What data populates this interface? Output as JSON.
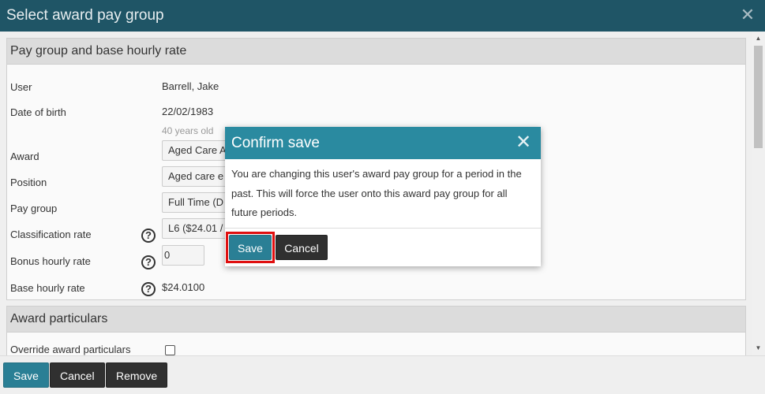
{
  "window": {
    "title": "Select award pay group",
    "close_icon": "close-icon"
  },
  "pay_group_panel": {
    "heading": "Pay group and base hourly rate",
    "user": {
      "label": "User",
      "value": "Barrell, Jake"
    },
    "dob": {
      "label": "Date of birth",
      "value": "22/02/1983",
      "age": "40 years old"
    },
    "award": {
      "label": "Award",
      "value": "Aged Care A"
    },
    "position": {
      "label": "Position",
      "value": "Aged care e"
    },
    "pay_group": {
      "label": "Pay group",
      "value": "Full Time (D"
    },
    "classification_rate": {
      "label": "Classification rate",
      "value": "L6 ($24.01 /"
    },
    "bonus_hourly_rate": {
      "label": "Bonus hourly rate",
      "value": "0"
    },
    "base_hourly_rate": {
      "label": "Base hourly rate",
      "value": "$24.0100"
    },
    "help_glyph": "?"
  },
  "award_particulars_panel": {
    "heading": "Award particulars",
    "override": {
      "label": "Override award particulars",
      "checked": false
    }
  },
  "footer": {
    "save": "Save",
    "cancel": "Cancel",
    "remove": "Remove"
  },
  "dialog": {
    "title": "Confirm save",
    "message": "You are changing this user's award pay group for a period in the past. This will force the user onto this award pay group for all future periods.",
    "save": "Save",
    "cancel": "Cancel"
  },
  "colors": {
    "titlebar": "#1f5566",
    "dialog_header": "#2a8aa0",
    "primary_button": "#2a7f95",
    "dark_button": "#303030",
    "highlight": "#e01010"
  }
}
